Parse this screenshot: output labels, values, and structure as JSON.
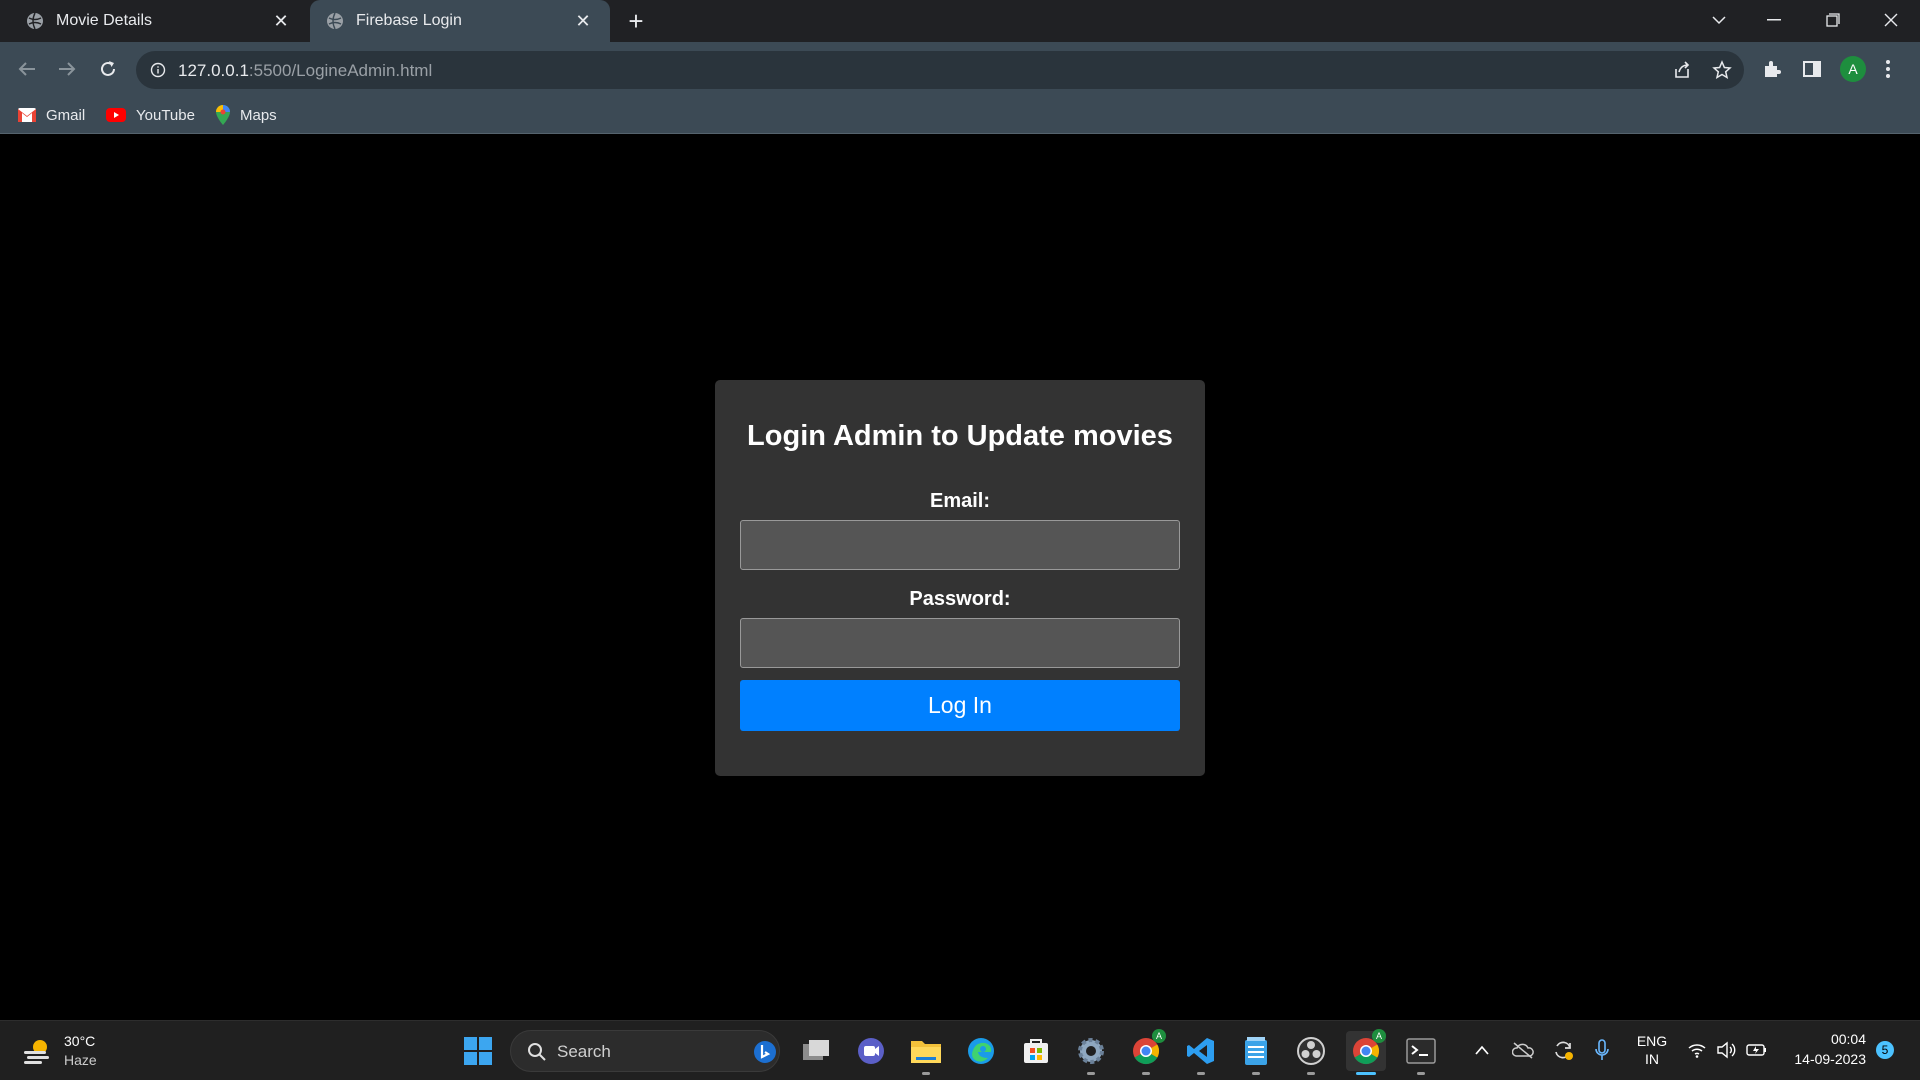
{
  "browser": {
    "tabs": [
      {
        "title": "Movie Details",
        "active": false
      },
      {
        "title": "Firebase Login",
        "active": true
      }
    ],
    "url_host": "127.0.0.1",
    "url_rest": ":5500/LogineAdmin.html",
    "profile_initial": "A",
    "bookmarks": [
      {
        "label": "Gmail",
        "icon": "gmail-icon"
      },
      {
        "label": "YouTube",
        "icon": "youtube-icon"
      },
      {
        "label": "Maps",
        "icon": "maps-icon"
      }
    ]
  },
  "page": {
    "title": "Login Admin to Update movies",
    "email_label": "Email:",
    "email_value": "",
    "password_label": "Password:",
    "password_value": "",
    "login_button": "Log In"
  },
  "taskbar": {
    "weather_temp": "30°C",
    "weather_desc": "Haze",
    "search_label": "Search",
    "lang_line1": "ENG",
    "lang_line2": "IN",
    "time": "00:04",
    "date": "14-09-2023",
    "notification_count": "5"
  },
  "colors": {
    "accent_button": "#0080ff",
    "card_bg": "#333333",
    "page_bg": "#000000"
  }
}
